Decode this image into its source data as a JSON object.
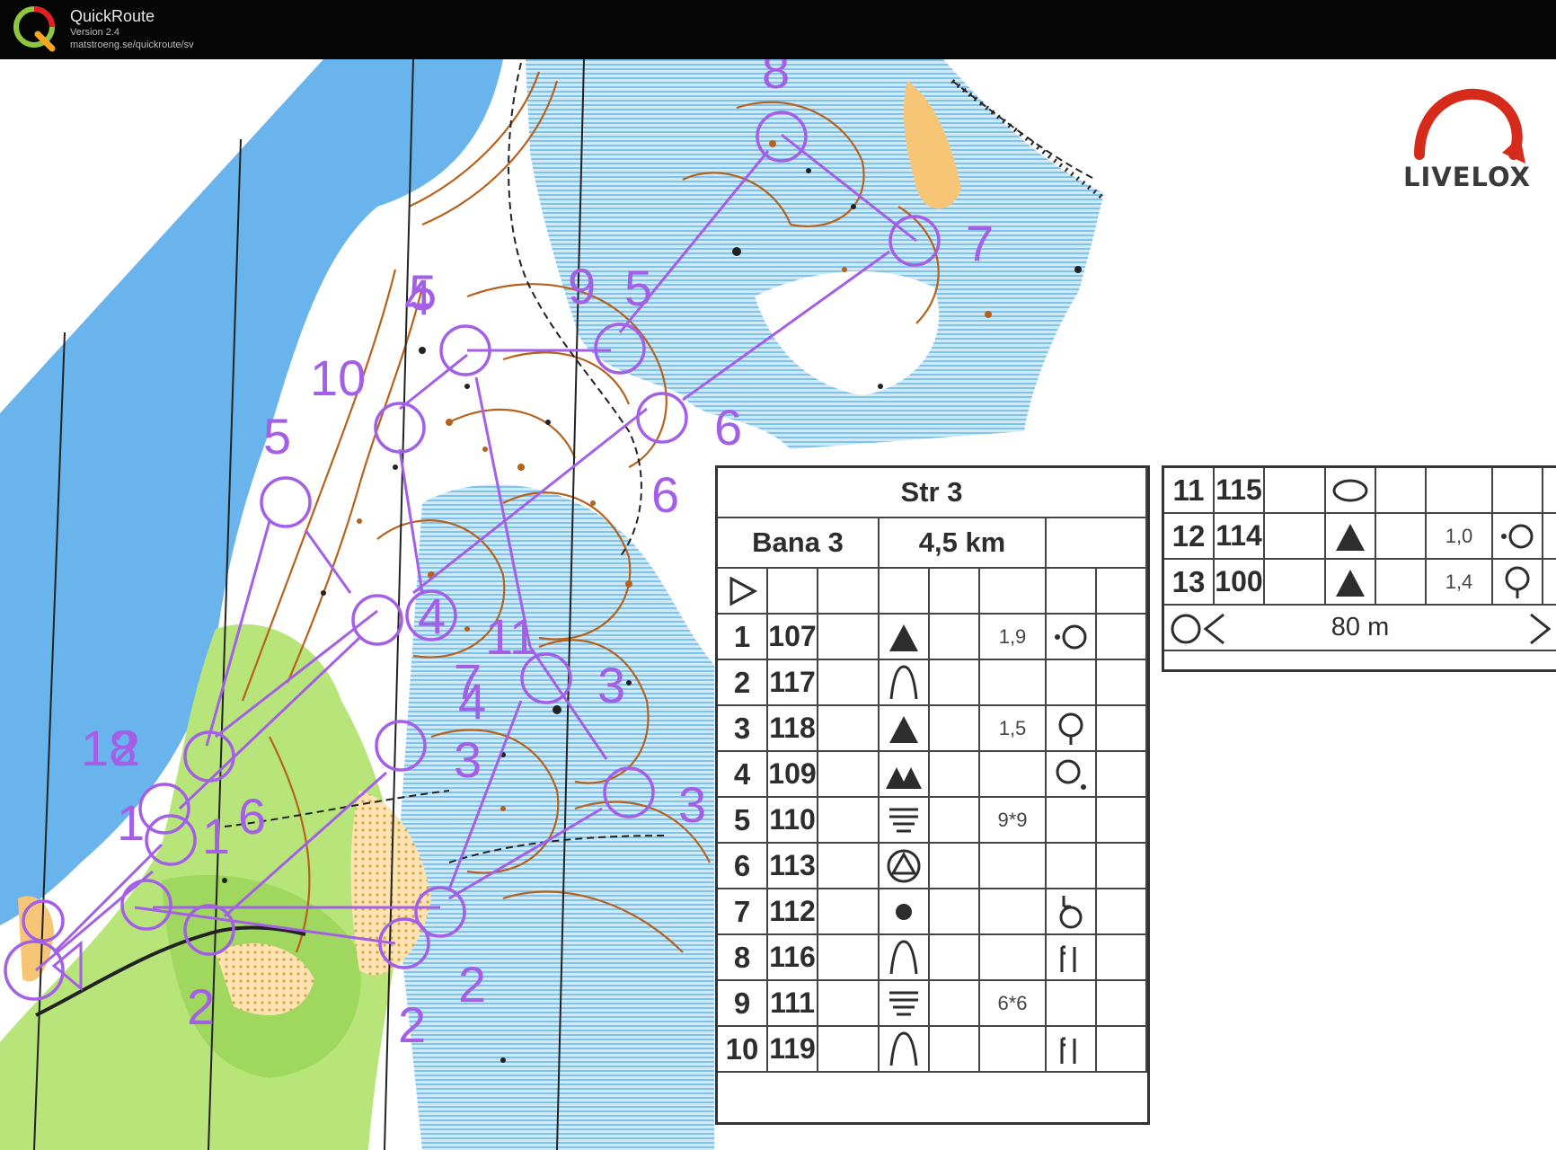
{
  "app": {
    "name": "QuickRoute",
    "version": "Version 2.4",
    "url": "matstroeng.se/quickroute/sv"
  },
  "branding": {
    "livelox": "LIVELOX"
  },
  "map_labels": [
    "8",
    "7",
    "9",
    "5",
    "4",
    "5",
    "10",
    "6",
    "5",
    "6",
    "4",
    "11",
    "7",
    "3",
    "4",
    "3",
    "18",
    "2",
    "1",
    "6",
    "1",
    "3",
    "2",
    "2",
    "2"
  ],
  "description_sheet": {
    "event": "Str 3",
    "course": "Bana 3",
    "length": "4,5 km",
    "rows": [
      {
        "n": "1",
        "code": "107",
        "feature": "knoll",
        "dim": "1,9",
        "detail": "left-of-circle"
      },
      {
        "n": "2",
        "code": "117",
        "feature": "re-entrant",
        "dim": "",
        "detail": ""
      },
      {
        "n": "3",
        "code": "118",
        "feature": "knoll",
        "dim": "1,5",
        "detail": "foot-of-circle"
      },
      {
        "n": "4",
        "code": "109",
        "feature": "knolls",
        "dim": "",
        "detail": "southeast-of-circle"
      },
      {
        "n": "5",
        "code": "110",
        "feature": "marsh",
        "dim": "9*9",
        "detail": ""
      },
      {
        "n": "6",
        "code": "113",
        "feature": "boulder-in-circle",
        "dim": "",
        "detail": ""
      },
      {
        "n": "7",
        "code": "112",
        "feature": "dot",
        "dim": "",
        "detail": "west-foot"
      },
      {
        "n": "8",
        "code": "116",
        "feature": "re-entrant",
        "dim": "",
        "detail": "upper-part"
      },
      {
        "n": "9",
        "code": "111",
        "feature": "marsh",
        "dim": "6*6",
        "detail": ""
      },
      {
        "n": "10",
        "code": "119",
        "feature": "re-entrant",
        "dim": "",
        "detail": "upper-part"
      }
    ],
    "rows_right": [
      {
        "n": "11",
        "code": "115",
        "feature": "ellipse",
        "dim": "",
        "detail": ""
      },
      {
        "n": "12",
        "code": "114",
        "feature": "knoll",
        "dim": "1,0",
        "detail": "left-of-circle"
      },
      {
        "n": "13",
        "code": "100",
        "feature": "knoll",
        "dim": "1,4",
        "detail": "foot-of-circle"
      }
    ],
    "finish": "80 m"
  },
  "colors": {
    "course": "#a35fe6",
    "water": "#6ab4ee",
    "contour": "#b5621d",
    "green": "#b8e57a",
    "yellow": "#f6c676",
    "marsh": "#7fc2ea"
  }
}
